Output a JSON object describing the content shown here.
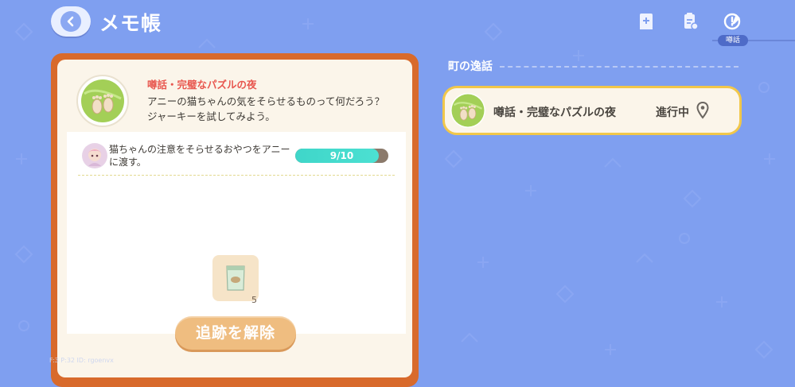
{
  "header": {
    "title": "メモ帳",
    "active_tab_label": "噂話",
    "icons": [
      "back-arrow-icon",
      "add-note-icon",
      "checklist-icon",
      "rumor-edit-icon"
    ]
  },
  "quest": {
    "title": "噂話・完璧なパズルの夜",
    "description": "アニーの猫ちゃんの気をそらせるものって何だろう？ジャーキーを試してみよう。",
    "task": {
      "text": "猫ちゃんの注意をそらせるおやつをアニーに渡す。",
      "progress_text": "9/10",
      "progress_fraction": 0.9
    },
    "item": {
      "count": "5"
    },
    "untrack_label": "追跡を解除"
  },
  "right_panel": {
    "section_label": "町の逸話",
    "items": [
      {
        "title": "噂話・完璧なパズルの夜",
        "status": "進行中"
      }
    ]
  },
  "debug_overlay": "F:3  P:32  ID: rgoenvx",
  "colors": {
    "background": "#7f9ff0",
    "card_frame": "#d86a2c",
    "quest_title": "#e8574f",
    "progress": "#3fd6c9",
    "button": "#efbd80",
    "highlight_border": "#f1c74a"
  }
}
